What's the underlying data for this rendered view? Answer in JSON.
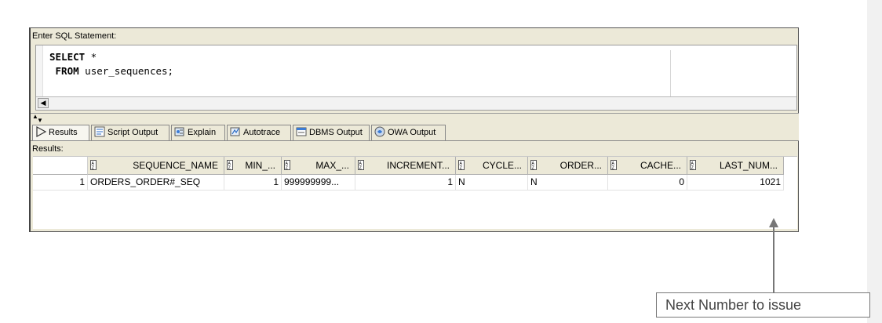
{
  "editor": {
    "label": "Enter SQL Statement:",
    "line1_kw": "SELECT",
    "line1_rest": " *",
    "line2_kw": " FROM",
    "line2_rest": " user_sequences;"
  },
  "tabs": [
    {
      "label": "Results",
      "icon": "play-icon"
    },
    {
      "label": "Script Output",
      "icon": "script-output-icon"
    },
    {
      "label": "Explain",
      "icon": "explain-icon"
    },
    {
      "label": "Autotrace",
      "icon": "autotrace-icon"
    },
    {
      "label": "DBMS Output",
      "icon": "dbms-output-icon"
    },
    {
      "label": "OWA Output",
      "icon": "owa-output-icon"
    }
  ],
  "results": {
    "label": "Results:",
    "columns": [
      "SEQUENCE_NAME",
      "MIN_...",
      "MAX_...",
      "INCREMENT...",
      "CYCLE...",
      "ORDER...",
      "CACHE...",
      "LAST_NUM..."
    ],
    "rows": [
      {
        "row_num": "1",
        "cells": [
          "ORDERS_ORDER#_SEQ",
          "1",
          "999999999...",
          "1",
          "N",
          "N",
          "0",
          "1021"
        ]
      }
    ]
  },
  "callout": {
    "text": "Next Number to issue"
  },
  "colors": {
    "chrome": "#ece9d8",
    "border": "#888888",
    "callout_text": "#444444"
  }
}
